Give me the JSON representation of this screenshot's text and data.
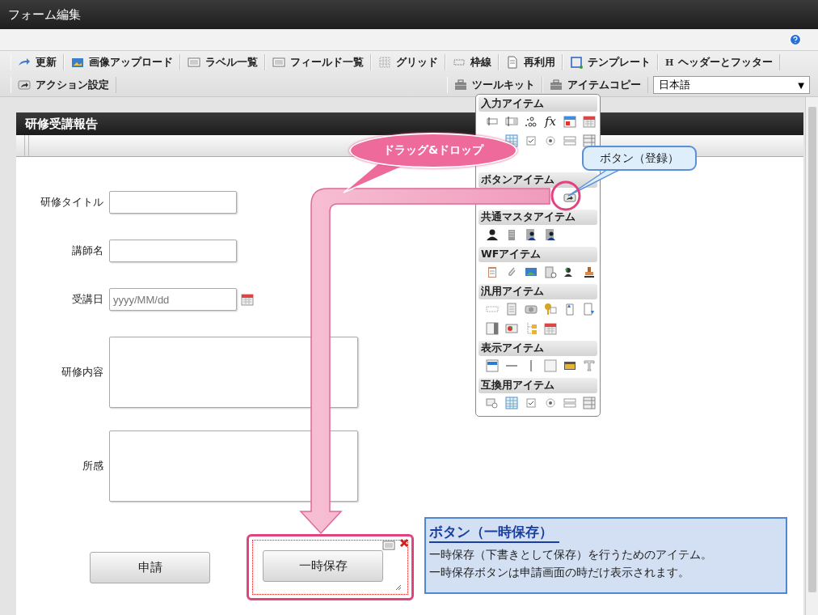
{
  "window": {
    "title": "フォーム編集"
  },
  "toolbar": {
    "row1": [
      {
        "label": "更新"
      },
      {
        "label": "画像アップロード"
      },
      {
        "label": "ラベル一覧"
      },
      {
        "label": "フィールド一覧"
      },
      {
        "label": "グリッド"
      },
      {
        "label": "枠線"
      },
      {
        "label": "再利用"
      },
      {
        "label": "テンプレート"
      },
      {
        "label": "ヘッダーとフッター",
        "glyph": "H"
      }
    ],
    "row2_left": [
      {
        "label": "アクション設定"
      }
    ],
    "row2_right": [
      {
        "label": "ツールキット"
      },
      {
        "label": "アイテムコピー"
      }
    ],
    "language": {
      "value": "日本語",
      "caret": "▼"
    }
  },
  "form": {
    "title": "研修受講報告",
    "fields": [
      {
        "kind": "text",
        "label": "研修タイトル"
      },
      {
        "kind": "text",
        "label": "講師名"
      },
      {
        "kind": "date",
        "label": "受講日",
        "placeholder": "yyyy/MM/dd"
      },
      {
        "kind": "textarea",
        "label": "研修内容"
      },
      {
        "kind": "textarea",
        "label": "所感"
      }
    ],
    "buttons": [
      {
        "label": "申請",
        "selected": false
      },
      {
        "label": "一時保存",
        "selected": true
      }
    ]
  },
  "toolkit": {
    "formula_glyph": "fx",
    "sections": [
      {
        "title": "入力アイテム"
      },
      {
        "title": "ボタンアイテム"
      },
      {
        "title": "共通マスタアイテム"
      },
      {
        "title": "WFアイテム"
      },
      {
        "title": "汎用アイテム"
      },
      {
        "title": "表示アイテム"
      },
      {
        "title": "互換用アイテム"
      }
    ]
  },
  "annotations": {
    "drag_callout": "ドラッグ&ドロップ",
    "button_callout": "ボタン（登録）",
    "description": {
      "title": "ボタン（一時保存）",
      "lines": [
        "一時保存（下書きとして保存）を行うためのアイテム。",
        "一時保存ボタンは申請画面の時だけ表示されます。"
      ]
    }
  }
}
